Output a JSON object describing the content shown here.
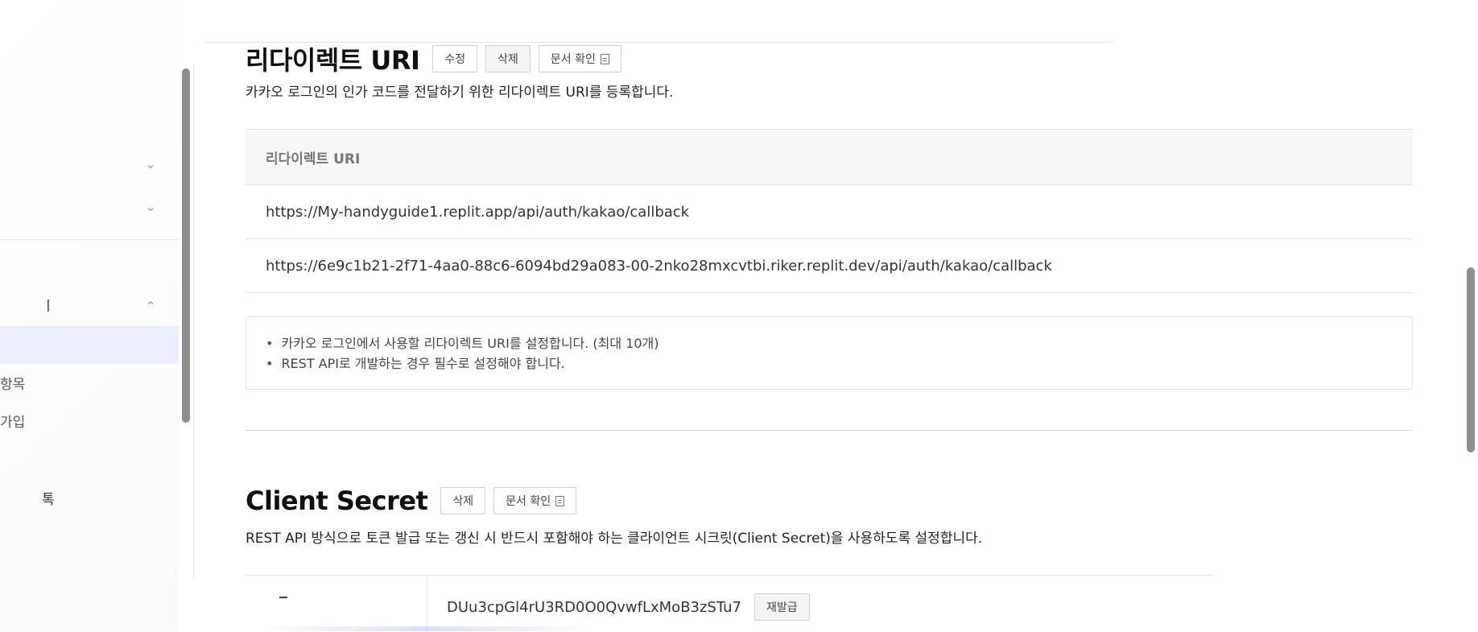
{
  "sidebar": {
    "partial_texts": [
      "ㅣ",
      "항목",
      "가입",
      "톡"
    ]
  },
  "redirect": {
    "title": "리다이렉트 URI",
    "buttons": {
      "edit": "수정",
      "delete": "삭제",
      "docs": "문서 확인"
    },
    "description": "카카오 로그인의 인가 코드를 전달하기 위한 리다이렉트 URI를 등록합니다.",
    "table_header": "리다이렉트 URI",
    "uris": [
      "https://My-handyguide1.replit.app/api/auth/kakao/callback",
      "https://6e9c1b21-2f71-4aa0-88c6-6094bd29a083-00-2nko28mxcvtbi.riker.replit.dev/api/auth/kakao/callback"
    ],
    "notes": [
      "카카오 로그인에서 사용할 리다이렉트 URI를 설정합니다. (최대 10개)",
      "REST API로 개발하는 경우 필수로 설정해야 합니다."
    ]
  },
  "client_secret": {
    "title": "Client Secret",
    "buttons": {
      "delete": "삭제",
      "docs": "문서 확인"
    },
    "description": "REST API 방식으로 토큰 발급 또는 갱신 시 반드시 포함해야 하는 클라이언트 시크릿(Client Secret)을 사용하도록 설정합니다.",
    "code": "DUu3cpGl4rU3RD0O0QvwfLxMoB3zSTu7",
    "reissue_label": "재발급"
  },
  "icons": {
    "chevron_down": "chevron-down-icon",
    "chevron_up": "chevron-up-icon",
    "document": "document-icon"
  }
}
